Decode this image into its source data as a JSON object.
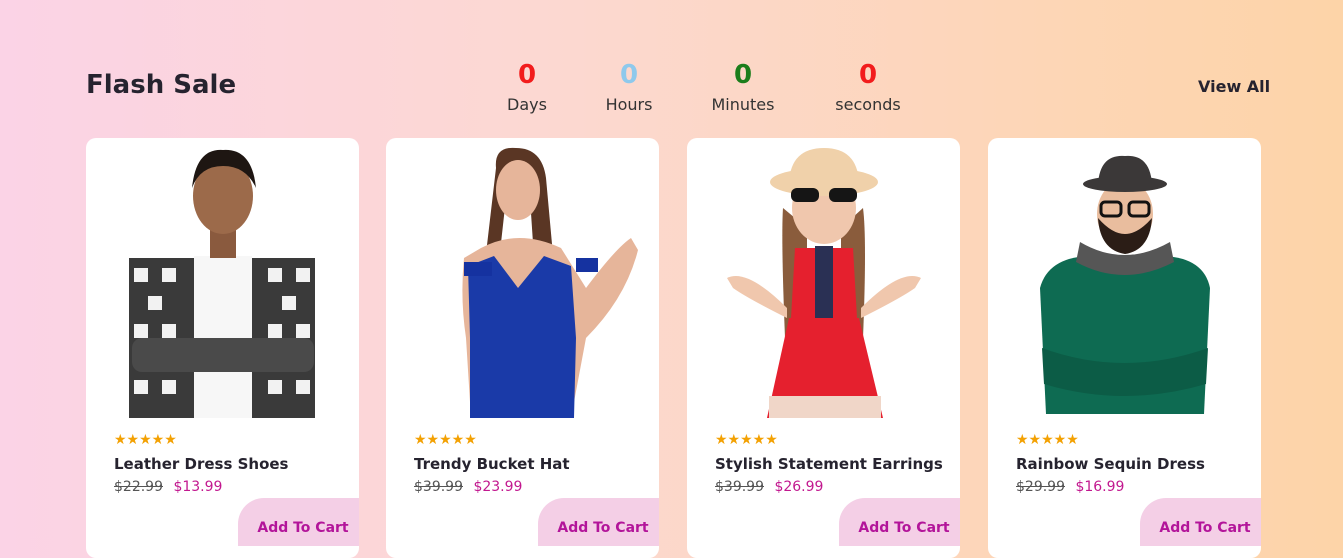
{
  "header": {
    "title": "Flash Sale",
    "view_all": "View All"
  },
  "countdown": [
    {
      "value": "0",
      "label": "Days",
      "color": "#f21c1c"
    },
    {
      "value": "0",
      "label": "Hours",
      "color": "#8ec9ec"
    },
    {
      "value": "0",
      "label": "Minutes",
      "color": "#1b7d1b"
    },
    {
      "value": "0",
      "label": "seconds",
      "color": "#f21c1c"
    }
  ],
  "products": [
    {
      "stars": "★★★★★",
      "name": "Leather Dress Shoes",
      "old_price": "$22.99",
      "new_price": "$13.99",
      "button": "Add To Cart"
    },
    {
      "stars": "★★★★★",
      "name": "Trendy Bucket Hat",
      "old_price": "$39.99",
      "new_price": "$23.99",
      "button": "Add To Cart"
    },
    {
      "stars": "★★★★★",
      "name": "Stylish Statement Earrings",
      "old_price": "$39.99",
      "new_price": "$26.99",
      "button": "Add To Cart"
    },
    {
      "stars": "★★★★★",
      "name": "Rainbow Sequin Dress",
      "old_price": "$29.99",
      "new_price": "$16.99",
      "button": "Add To Cart"
    }
  ],
  "colors": {
    "star": "#f3a103",
    "sale_price": "#c2188f",
    "button_bg": "#f4cfe6",
    "button_text": "#b3159a"
  }
}
